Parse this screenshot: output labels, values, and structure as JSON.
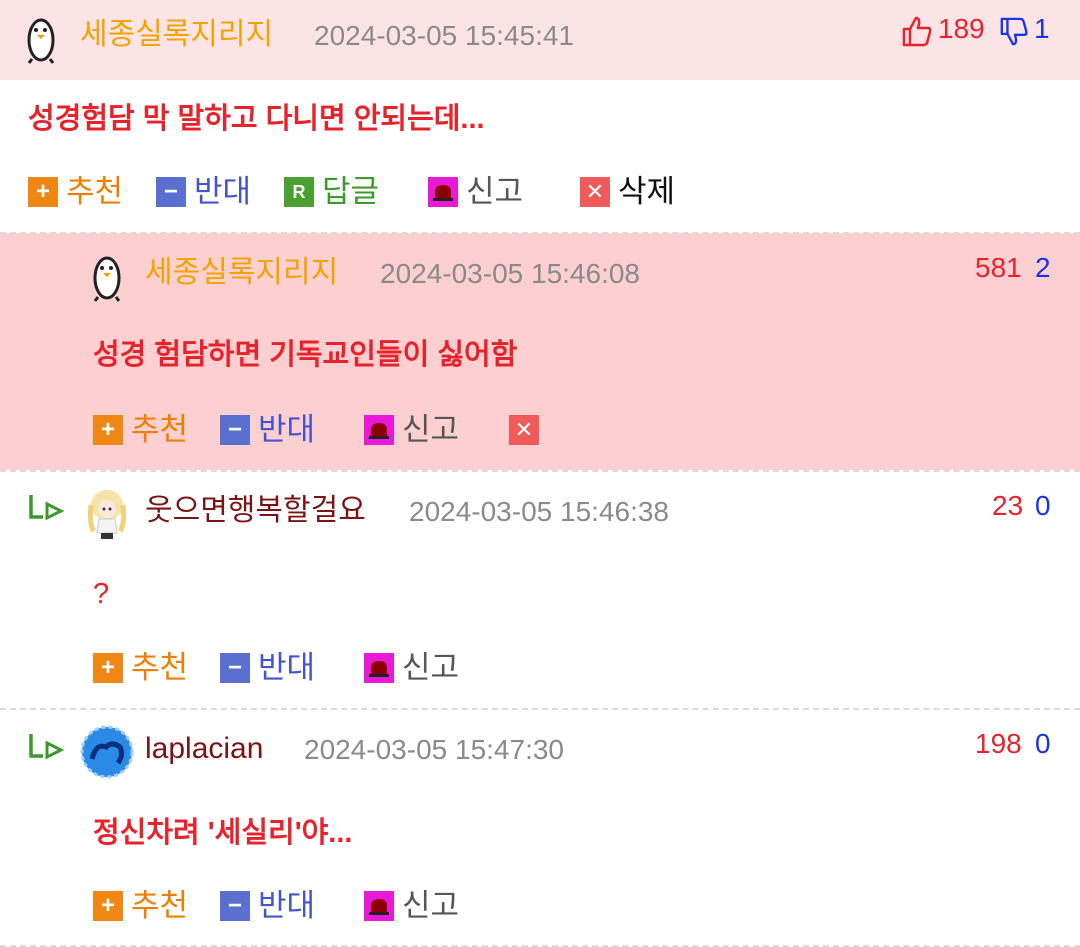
{
  "comments": [
    {
      "author": "세종실록지리지",
      "time": "2024-03-05 15:45:41",
      "up": "189",
      "down": "1",
      "content": "성경험담 막 말하고 다니면 안되는데...",
      "actions": {
        "recommend": "추천",
        "oppose": "반대",
        "reply": "답글",
        "report": "신고",
        "delete": "삭제"
      }
    },
    {
      "author": "세종실록지리지",
      "time": "2024-03-05 15:46:08",
      "up": "581",
      "down": "2",
      "content": "성경 험담하면 기독교인들이 싫어함",
      "actions": {
        "recommend": "추천",
        "oppose": "반대",
        "report": "신고"
      }
    },
    {
      "author": "웃으면행복할걸요",
      "time": "2024-03-05 15:46:38",
      "up": "23",
      "down": "0",
      "content": "?",
      "actions": {
        "recommend": "추천",
        "oppose": "반대",
        "report": "신고"
      }
    },
    {
      "author": "laplacian",
      "time": "2024-03-05 15:47:30",
      "up": "198",
      "down": "0",
      "content": "정신차려 '세실리'야...",
      "actions": {
        "recommend": "추천",
        "oppose": "반대",
        "report": "신고"
      }
    }
  ],
  "icons": {
    "plus": "+",
    "minus": "−",
    "reply": "R",
    "delete": "✕"
  },
  "colors": {
    "highlight_bg": "#fce4e6",
    "reply_highlight_bg": "#fccfd0",
    "upvote": "#e8222a",
    "downvote": "#1a33e6",
    "author_gold": "#f2a300",
    "author_dark": "#7a1414"
  }
}
